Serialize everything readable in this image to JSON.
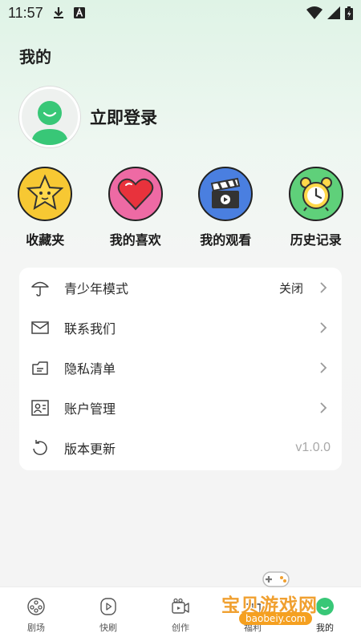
{
  "status_bar": {
    "time": "11:57",
    "left_icons": [
      "download-icon",
      "a-badge-icon"
    ],
    "right_icons": [
      "wifi-icon",
      "signal-icon",
      "battery-icon"
    ]
  },
  "header": {
    "title": "我的"
  },
  "profile": {
    "login_text": "立即登录"
  },
  "quick_actions": [
    {
      "label": "收藏夹",
      "icon": "star-icon",
      "color": "#f7c833"
    },
    {
      "label": "我的喜欢",
      "icon": "heart-icon",
      "color": "#ee6aa4"
    },
    {
      "label": "我的观看",
      "icon": "clapperboard-icon",
      "color": "#4a7fe0"
    },
    {
      "label": "历史记录",
      "icon": "alarm-clock-icon",
      "color": "#5fd07a"
    }
  ],
  "menu": {
    "items": [
      {
        "label": "青少年模式",
        "icon": "umbrella-icon",
        "value": "关闭"
      },
      {
        "label": "联系我们",
        "icon": "mail-icon"
      },
      {
        "label": "隐私清单",
        "icon": "document-icon"
      },
      {
        "label": "账户管理",
        "icon": "id-card-icon"
      },
      {
        "label": "版本更新",
        "icon": "refresh-icon",
        "version": "v1.0.0"
      }
    ]
  },
  "bottom_nav": {
    "items": [
      {
        "label": "剧场",
        "icon": "film-reel-icon"
      },
      {
        "label": "快刷",
        "icon": "play-circle-icon"
      },
      {
        "label": "创作",
        "icon": "video-camera-icon"
      },
      {
        "label": "福利",
        "icon": "gift-icon"
      },
      {
        "label": "我的",
        "icon": "profile-icon"
      }
    ],
    "active": "我的"
  },
  "watermark": {
    "text": "宝贝游戏网",
    "url": "baobeiy.com"
  },
  "colors": {
    "accent_green": "#38c777",
    "background_top": "#dff3e6"
  }
}
